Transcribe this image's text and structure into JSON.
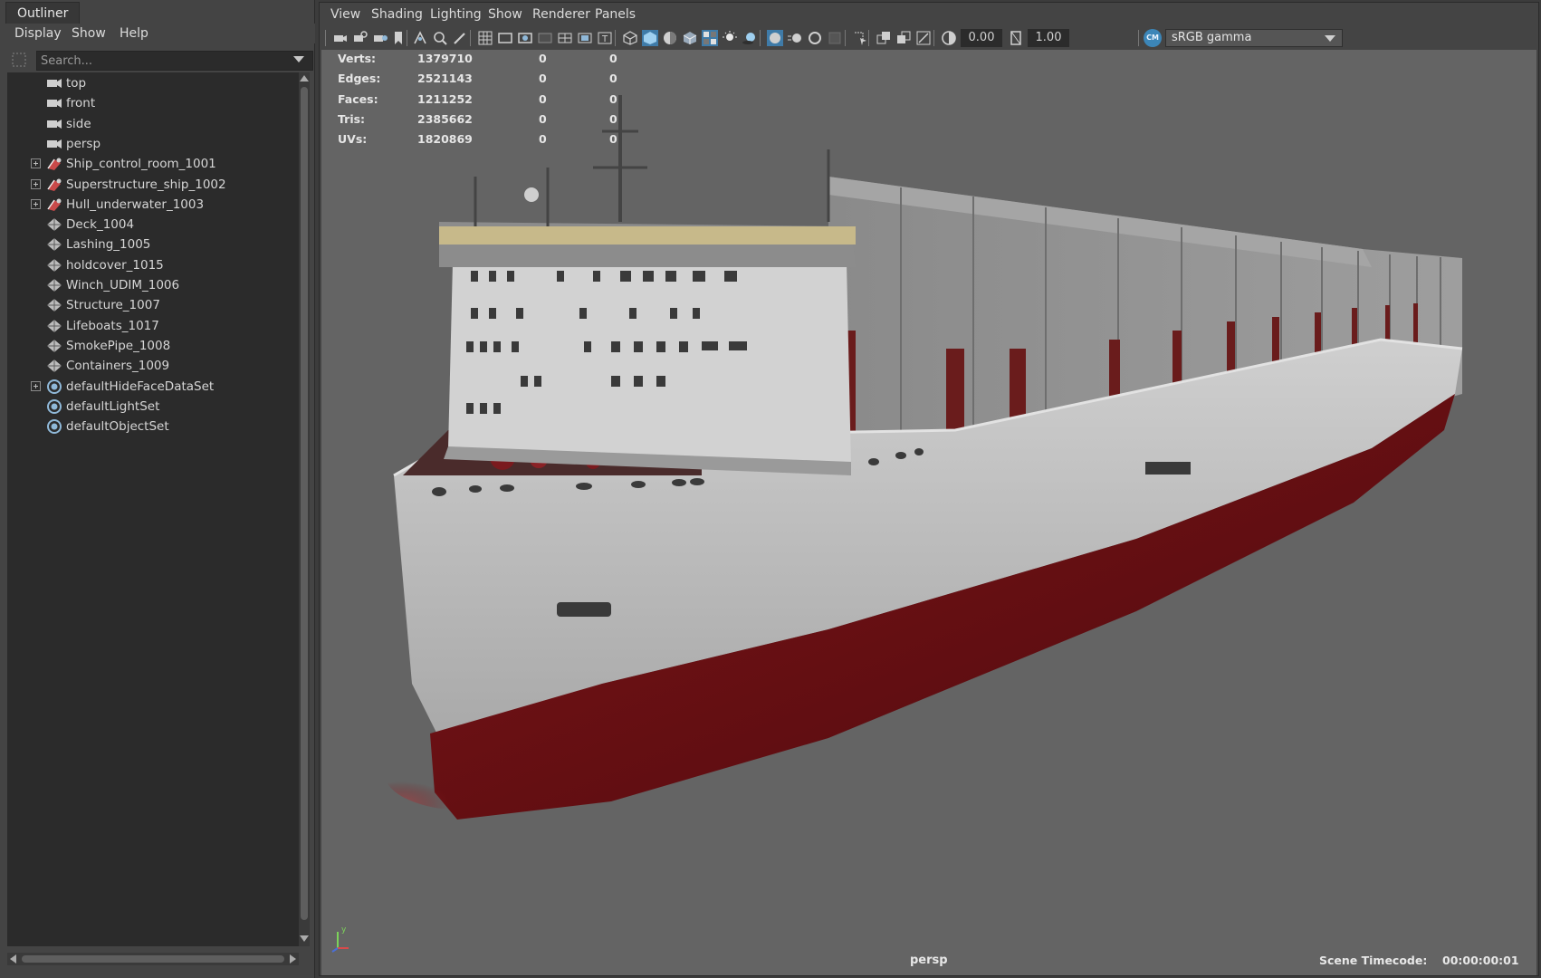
{
  "outliner": {
    "tab_title": "Outliner",
    "menu": [
      "Display",
      "Show",
      "Help"
    ],
    "search_placeholder": "Search...",
    "items": [
      {
        "label": "top",
        "icon": "camera-icon",
        "expandable": false
      },
      {
        "label": "front",
        "icon": "camera-icon",
        "expandable": false
      },
      {
        "label": "side",
        "icon": "camera-icon",
        "expandable": false
      },
      {
        "label": "persp",
        "icon": "camera-icon",
        "expandable": false
      },
      {
        "label": "Ship_control_room_1001",
        "icon": "group-icon",
        "expandable": true
      },
      {
        "label": "Superstructure_ship_1002",
        "icon": "group-icon",
        "expandable": true
      },
      {
        "label": "Hull_underwater_1003",
        "icon": "group-icon",
        "expandable": true
      },
      {
        "label": "Deck_1004",
        "icon": "mesh-icon",
        "expandable": false
      },
      {
        "label": "Lashing_1005",
        "icon": "mesh-icon",
        "expandable": false
      },
      {
        "label": "holdcover_1015",
        "icon": "mesh-icon",
        "expandable": false
      },
      {
        "label": "Winch_UDIM_1006",
        "icon": "mesh-icon",
        "expandable": false
      },
      {
        "label": "Structure_1007",
        "icon": "mesh-icon",
        "expandable": false
      },
      {
        "label": "Lifeboats_1017",
        "icon": "mesh-icon",
        "expandable": false
      },
      {
        "label": "SmokePipe_1008",
        "icon": "mesh-icon",
        "expandable": false
      },
      {
        "label": "Containers_1009",
        "icon": "mesh-icon",
        "expandable": false
      },
      {
        "label": "defaultHideFaceDataSet",
        "icon": "set-icon",
        "expandable": true
      },
      {
        "label": "defaultLightSet",
        "icon": "set-icon",
        "expandable": false
      },
      {
        "label": "defaultObjectSet",
        "icon": "set-icon",
        "expandable": false
      }
    ]
  },
  "panel": {
    "menu": [
      "View",
      "Shading",
      "Lighting",
      "Show",
      "Renderer",
      "Panels"
    ],
    "toolbar": {
      "exposure": "0.00",
      "gamma": "1.00",
      "color_management_badge": "CM",
      "colorspace": "sRGB gamma"
    }
  },
  "hud": {
    "rows": [
      {
        "label": "Verts:",
        "value": "1379710",
        "a": "0",
        "b": "0"
      },
      {
        "label": "Edges:",
        "value": "2521143",
        "a": "0",
        "b": "0"
      },
      {
        "label": "Faces:",
        "value": "1211252",
        "a": "0",
        "b": "0"
      },
      {
        "label": "Tris:",
        "value": "2385662",
        "a": "0",
        "b": "0"
      },
      {
        "label": "UVs:",
        "value": "1820869",
        "a": "0",
        "b": "0"
      }
    ],
    "camera": "persp",
    "timecode_label": "Scene Timecode:",
    "timecode_value": "00:00:00:01"
  },
  "colors": {
    "viewport_bg": "#646464",
    "hull_red": "#6e0f12",
    "hull_white": "#bcbcbc",
    "accent_blue": "#3c86b8"
  }
}
